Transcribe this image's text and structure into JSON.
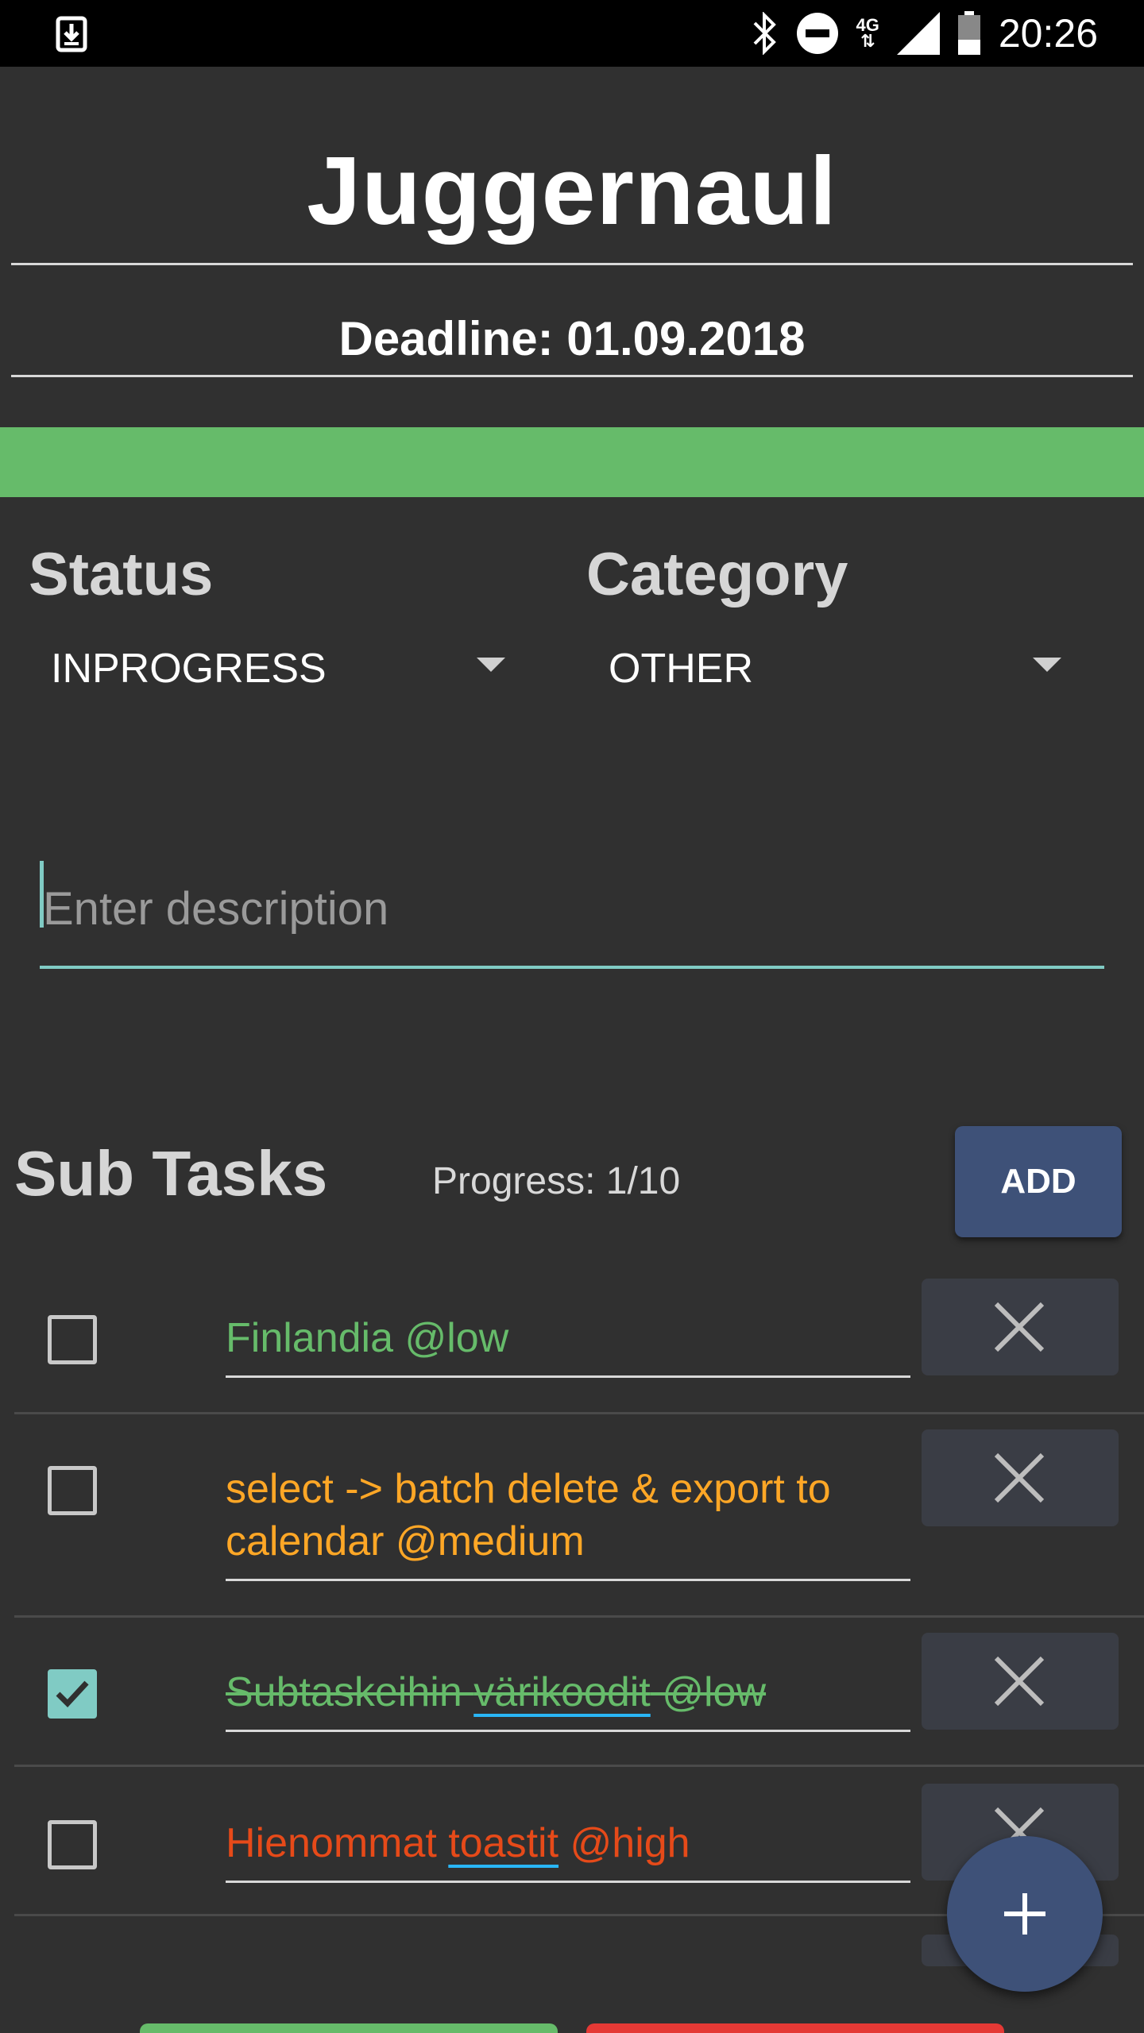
{
  "status_bar": {
    "time": "20:26",
    "network": "4G",
    "icons": [
      "download-icon",
      "bluetooth-icon",
      "do-not-disturb-icon",
      "signal-icon",
      "battery-icon"
    ]
  },
  "header": {
    "title": "Juggernaul",
    "deadline": "Deadline: 01.09.2018",
    "progress_color": "#66bb6a"
  },
  "status_select": {
    "label": "Status",
    "value": "INPROGRESS"
  },
  "category_select": {
    "label": "Category",
    "value": "OTHER"
  },
  "description": {
    "placeholder": "Enter description",
    "value": ""
  },
  "subtasks": {
    "title": "Sub Tasks",
    "progress": "Progress: 1/10",
    "add_label": "ADD",
    "items": [
      {
        "parts": [
          "Finlandia @low"
        ],
        "color": "#66bb6a",
        "checked": false
      },
      {
        "parts": [
          "select -> batch delete & export to calendar @medium"
        ],
        "color": "#ffa726",
        "checked": false
      },
      {
        "parts": [
          "Subtaskeihin ",
          "värikoodit",
          " @low"
        ],
        "color": "#66bb6a",
        "checked": true
      },
      {
        "parts": [
          "Hienommat ",
          "toastit",
          " @high"
        ],
        "color": "#e64a19",
        "checked": false
      }
    ]
  },
  "colors": {
    "background": "#303030",
    "accent": "#80cbc4",
    "button": "#3e5178",
    "low": "#66bb6a",
    "medium": "#ffa726",
    "high": "#e64a19",
    "delete_bg": "#3a3d45"
  }
}
